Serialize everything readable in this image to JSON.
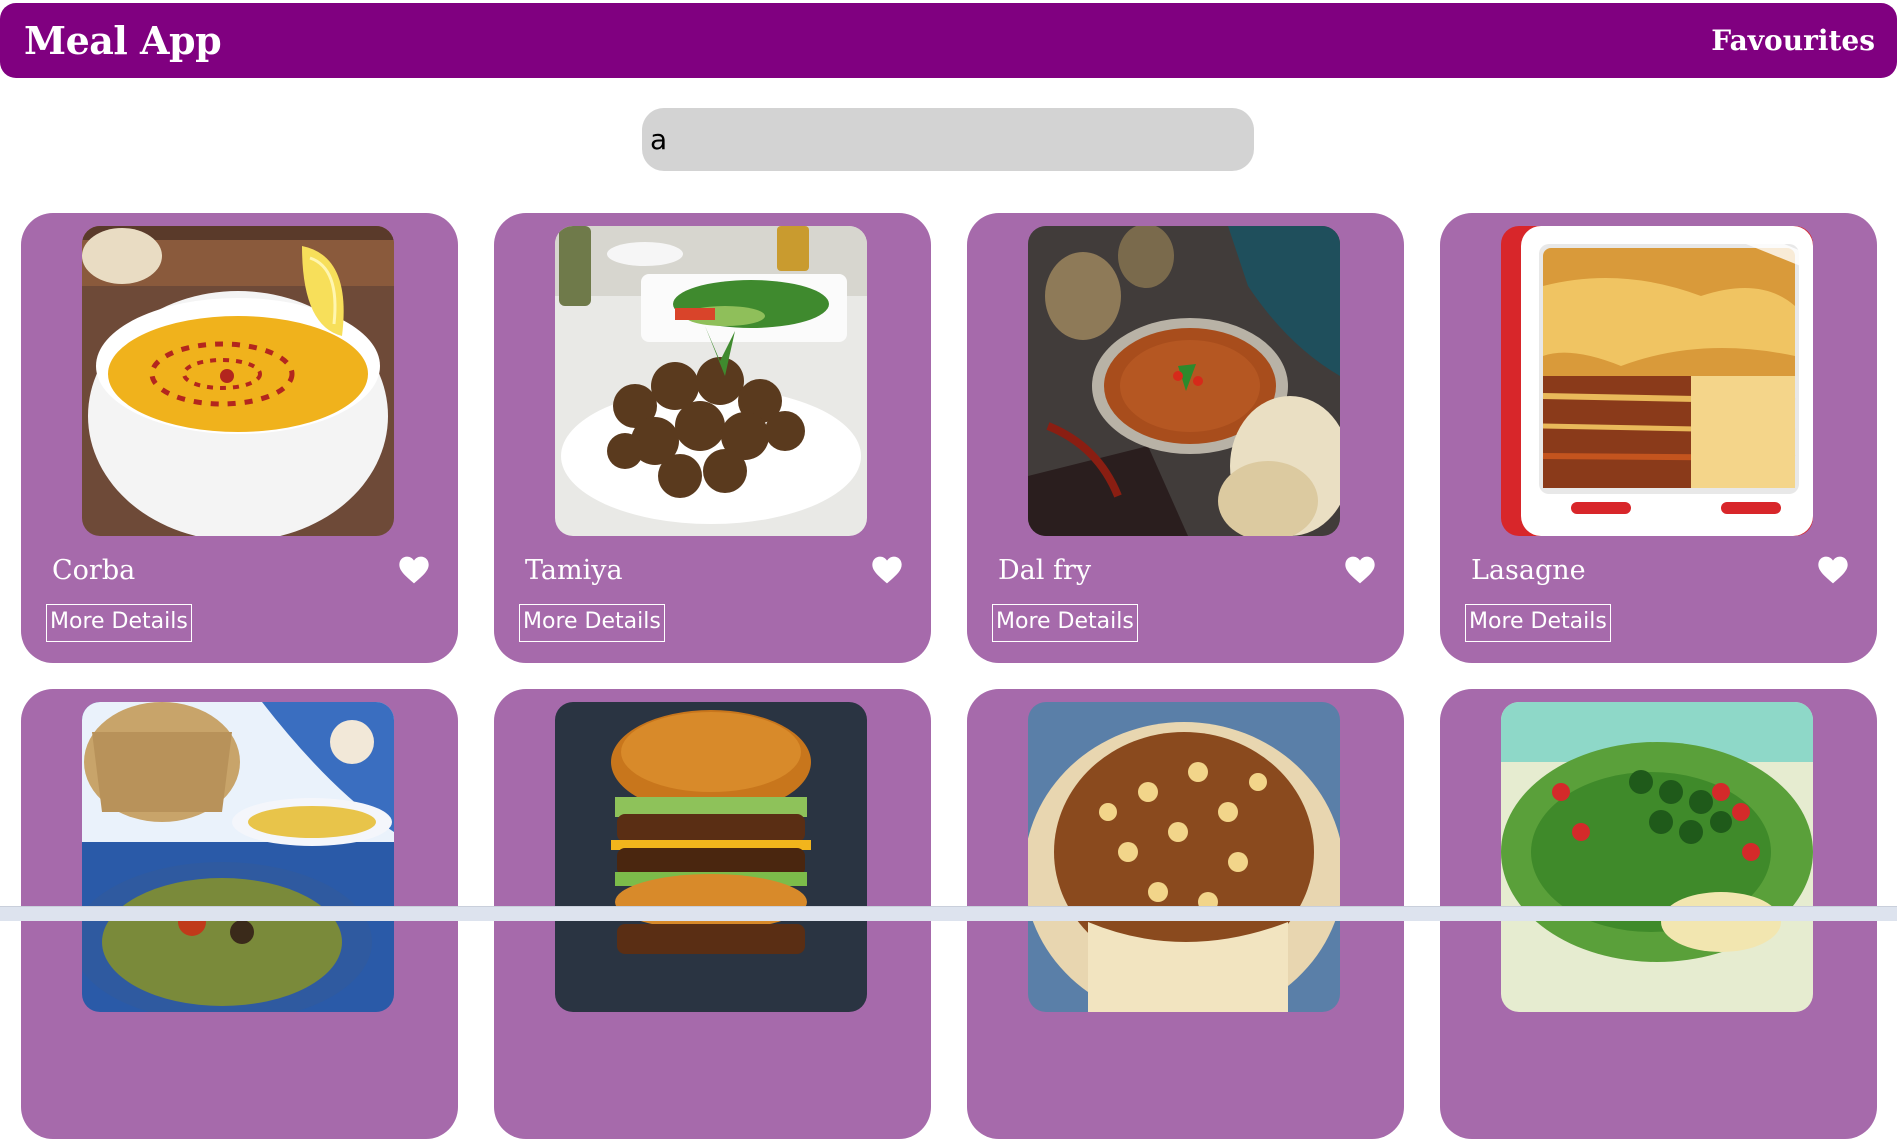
{
  "header": {
    "title": "Meal App",
    "favourites_label": "Favourites"
  },
  "search": {
    "value": "a"
  },
  "meals": [
    {
      "name": "Corba",
      "button": "More Details",
      "icon": "heart-icon"
    },
    {
      "name": "Tamiya",
      "button": "More Details",
      "icon": "heart-icon"
    },
    {
      "name": "Dal fry",
      "button": "More Details",
      "icon": "heart-icon"
    },
    {
      "name": "Lasagne",
      "button": "More Details",
      "icon": "heart-icon"
    },
    {
      "name": "",
      "button": "",
      "icon": ""
    },
    {
      "name": "",
      "button": "",
      "icon": ""
    },
    {
      "name": "",
      "button": "",
      "icon": ""
    },
    {
      "name": "",
      "button": "",
      "icon": ""
    }
  ],
  "colors": {
    "navbar": "#800080",
    "card": "#a66aab",
    "search_bg": "#d3d3d3",
    "text_light": "#ffffff"
  }
}
